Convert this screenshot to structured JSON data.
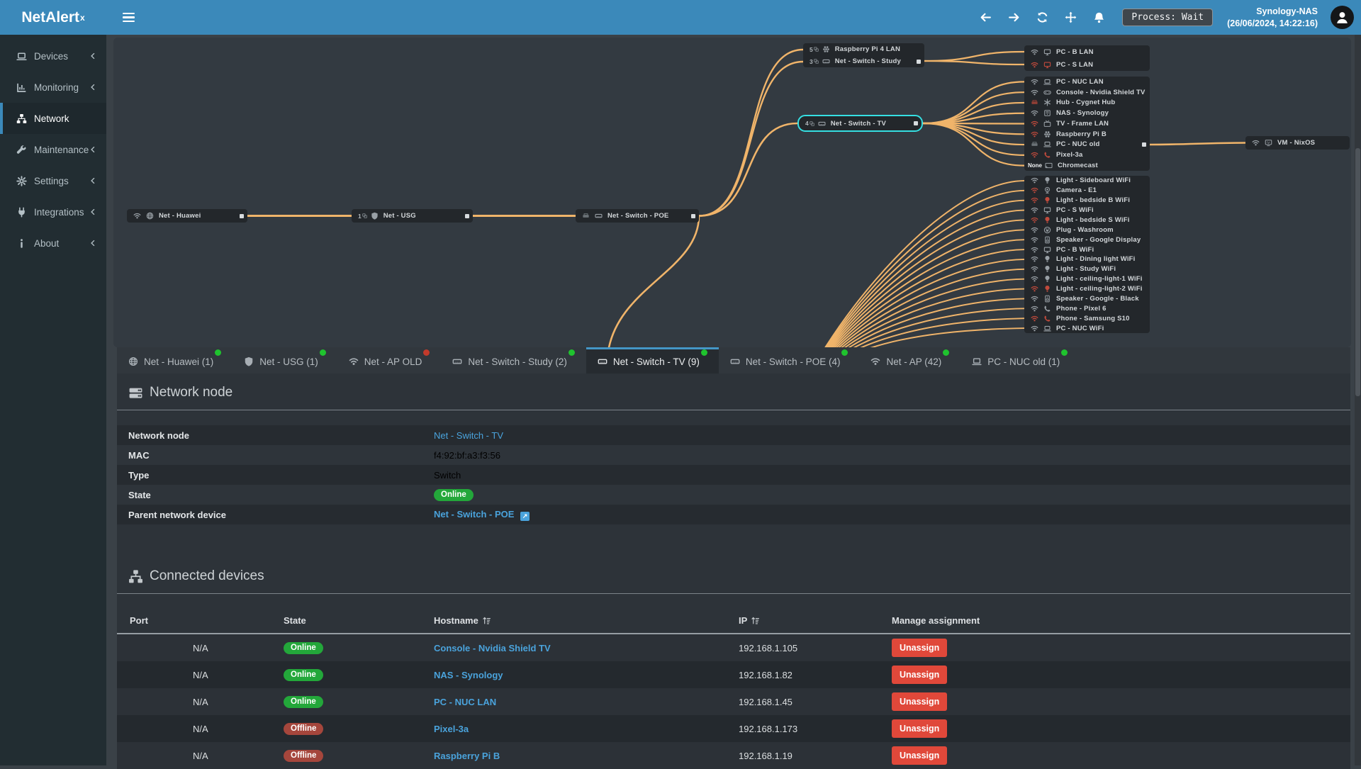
{
  "colors": {
    "topbar_blue": "#3b89ba",
    "sidebar_bg": "#222d32",
    "edge_orange": "#f0b46a",
    "selected_cyan": "#35dfe2",
    "link_blue": "#4aa3dc",
    "online_green": "#23a73a",
    "offline_maroon": "#a5463c",
    "danger_red": "#e0483a",
    "tab_dot_green": "#1fc32e",
    "tab_dot_red": "#c23a2b"
  },
  "topbar": {
    "logo": "NetAlert",
    "logo_sup": "x",
    "process": "Process: Wait",
    "host": "Synology-NAS",
    "time": "(26/06/2024, 14:22:16)"
  },
  "sidebar": {
    "items": [
      {
        "label": "Devices",
        "icon": "laptop-icon",
        "chevron": true,
        "active": false
      },
      {
        "label": "Monitoring",
        "icon": "chart-icon",
        "chevron": true,
        "active": false
      },
      {
        "label": "Network",
        "icon": "sitemap-icon",
        "chevron": false,
        "active": true
      },
      {
        "label": "Maintenance",
        "icon": "wrench-icon",
        "chevron": true,
        "active": false
      },
      {
        "label": "Settings",
        "icon": "gear-icon",
        "chevron": true,
        "active": false
      },
      {
        "label": "Integrations",
        "icon": "plug-icon",
        "chevron": true,
        "active": false
      },
      {
        "label": "About",
        "icon": "info-icon",
        "chevron": true,
        "active": false
      }
    ]
  },
  "topology": {
    "nodes": {
      "huawei": {
        "rows": [
          {
            "icons": [
              [
                "wifi-icon",
                "grey"
              ],
              [
                "globe-icon",
                "grey"
              ]
            ],
            "label": "Net - Huawei",
            "port": true
          }
        ]
      },
      "usg": {
        "rows": [
          {
            "count": "1",
            "icons": [
              [
                "shield-icon",
                "grey"
              ]
            ],
            "label": "Net - USG",
            "port": true
          }
        ]
      },
      "poe": {
        "rows": [
          {
            "icons": [
              [
                "ethernet-icon",
                "darkgrey"
              ],
              [
                "switch-icon",
                "grey"
              ]
            ],
            "label": "Net - Switch - POE",
            "port": true
          }
        ]
      },
      "study": {
        "rows": [
          {
            "count": "5",
            "icons": [
              [
                "raspberry-icon",
                "grey"
              ]
            ],
            "label": "Raspberry Pi 4 LAN"
          },
          {
            "count": "3",
            "icons": [
              [
                "switch-icon",
                "grey"
              ]
            ],
            "label": "Net - Switch - Study",
            "port": true
          }
        ]
      },
      "tv": {
        "selected": true,
        "rows": [
          {
            "count": "4",
            "icons": [
              [
                "switch-icon",
                "grey"
              ]
            ],
            "label": "Net - Switch - TV",
            "port": true
          }
        ]
      },
      "vm": {
        "rows": [
          {
            "icons": [
              [
                "wifi-icon",
                "grey"
              ],
              [
                "vm-icon",
                "grey"
              ]
            ],
            "label": "VM - NixOS"
          }
        ]
      },
      "group1": {
        "rows": [
          {
            "status": [
              "wifi-icon",
              "grey"
            ],
            "device": [
              "monitor-icon",
              "grey"
            ],
            "label": "PC - B LAN"
          },
          {
            "status": [
              "wifi-icon",
              "red"
            ],
            "device": [
              "monitor-icon",
              "red"
            ],
            "label": "PC - S LAN"
          }
        ]
      },
      "group2": {
        "rows": [
          {
            "status": [
              "wifi-icon",
              "grey"
            ],
            "device": [
              "laptop-icon",
              "grey"
            ],
            "label": "PC - NUC LAN"
          },
          {
            "status": [
              "wifi-icon",
              "grey"
            ],
            "device": [
              "gamepad-icon",
              "grey"
            ],
            "label": "Console - Nvidia Shield TV"
          },
          {
            "status": [
              "ethernet-icon",
              "darkred"
            ],
            "device": [
              "hub-icon",
              "grey"
            ],
            "label": "Hub - Cygnet Hub"
          },
          {
            "status": [
              "wifi-icon",
              "grey"
            ],
            "device": [
              "nas-icon",
              "grey"
            ],
            "label": "NAS - Synology"
          },
          {
            "status": [
              "wifi-icon",
              "red"
            ],
            "device": [
              "tv-icon",
              "grey"
            ],
            "label": "TV - Frame LAN"
          },
          {
            "status": [
              "wifi-icon",
              "red"
            ],
            "device": [
              "raspberry-icon",
              "grey"
            ],
            "label": "Raspberry Pi B"
          },
          {
            "status": [
              "ethernet-icon",
              "darkgrey"
            ],
            "device": [
              "laptop-icon",
              "grey"
            ],
            "label": "PC - NUC old",
            "port": true
          },
          {
            "status": [
              "wifi-icon",
              "red"
            ],
            "device": [
              "phone-icon",
              "red"
            ],
            "label": "Pixel-3a"
          },
          {
            "status_text": "None",
            "device": [
              "chromecast-icon",
              "grey"
            ],
            "label": "Chromecast"
          }
        ]
      },
      "group3": {
        "rows": [
          {
            "status": [
              "wifi-icon",
              "grey"
            ],
            "device": [
              "bulb-icon",
              "grey"
            ],
            "label": "Light - Sideboard WiFi"
          },
          {
            "status": [
              "wifi-icon",
              "red"
            ],
            "device": [
              "camera-icon",
              "grey"
            ],
            "label": "Camera - E1"
          },
          {
            "status": [
              "wifi-icon",
              "red"
            ],
            "device": [
              "bulb-icon",
              "red"
            ],
            "label": "Light - bedside B WiFi"
          },
          {
            "status": [
              "wifi-icon",
              "grey"
            ],
            "device": [
              "monitor-icon",
              "grey"
            ],
            "label": "PC - S WiFi"
          },
          {
            "status": [
              "wifi-icon",
              "red"
            ],
            "device": [
              "bulb-icon",
              "red"
            ],
            "label": "Light - bedside S WiFi"
          },
          {
            "status": [
              "wifi-icon",
              "grey"
            ],
            "device": [
              "smartplug-icon",
              "grey"
            ],
            "label": "Plug - Washroom"
          },
          {
            "status": [
              "wifi-icon",
              "grey"
            ],
            "device": [
              "speaker-icon",
              "grey"
            ],
            "label": "Speaker - Google Display"
          },
          {
            "status": [
              "wifi-icon",
              "grey"
            ],
            "device": [
              "monitor-icon",
              "grey"
            ],
            "label": "PC - B WiFi"
          },
          {
            "status": [
              "wifi-icon",
              "grey"
            ],
            "device": [
              "bulb-icon",
              "grey"
            ],
            "label": "Light - Dining light WiFi"
          },
          {
            "status": [
              "wifi-icon",
              "grey"
            ],
            "device": [
              "bulb-icon",
              "grey"
            ],
            "label": "Light - Study WiFi"
          },
          {
            "status": [
              "wifi-icon",
              "grey"
            ],
            "device": [
              "bulb-icon",
              "grey"
            ],
            "label": "Light - ceiling-light-1 WiFi"
          },
          {
            "status": [
              "wifi-icon",
              "red"
            ],
            "device": [
              "bulb-icon",
              "red"
            ],
            "label": "Light - ceiling-light-2 WiFi"
          },
          {
            "status": [
              "wifi-icon",
              "grey"
            ],
            "device": [
              "speaker-icon",
              "grey"
            ],
            "label": "Speaker - Google - Black"
          },
          {
            "status": [
              "wifi-icon",
              "grey"
            ],
            "device": [
              "phone-icon",
              "grey"
            ],
            "label": "Phone - Pixel 6"
          },
          {
            "status": [
              "wifi-icon",
              "red"
            ],
            "device": [
              "phone-icon",
              "red"
            ],
            "label": "Phone - Samsung S10"
          },
          {
            "status": [
              "wifi-icon",
              "grey"
            ],
            "device": [
              "laptop-icon",
              "grey"
            ],
            "label": "PC - NUC WiFi"
          }
        ]
      }
    }
  },
  "tabs": {
    "items": [
      {
        "label": "Net - Huawei (1)",
        "icon": "globe-icon",
        "dot": "green",
        "active": false
      },
      {
        "label": "Net - USG (1)",
        "icon": "shield-icon",
        "dot": "green",
        "active": false
      },
      {
        "label": "Net - AP OLD",
        "icon": "wifi-icon",
        "dot": "red",
        "active": false
      },
      {
        "label": "Net - Switch - Study (2)",
        "icon": "switch-icon",
        "dot": "green",
        "active": false
      },
      {
        "label": "Net - Switch - TV (9)",
        "icon": "switch-icon",
        "dot": "green",
        "active": true
      },
      {
        "label": "Net - Switch - POE (4)",
        "icon": "switch-icon",
        "dot": "green",
        "active": false
      },
      {
        "label": "Net - AP (42)",
        "icon": "wifi-icon",
        "dot": "green",
        "active": false
      },
      {
        "label": "PC - NUC old (1)",
        "icon": "laptop-icon",
        "dot": "green",
        "active": false
      }
    ]
  },
  "network_node": {
    "title": "Network node",
    "rows": [
      {
        "label": "Network node",
        "type": "link",
        "value": "Net - Switch - TV"
      },
      {
        "label": "MAC",
        "type": "text",
        "value": "f4:92:bf:a3:f3:56"
      },
      {
        "label": "Type",
        "type": "text",
        "value": "Switch"
      },
      {
        "label": "State",
        "type": "badge",
        "value": "Online"
      },
      {
        "label": "Parent network device",
        "type": "link-ext",
        "value": "Net - Switch - POE"
      }
    ]
  },
  "connected_devices": {
    "title": "Connected devices",
    "columns": [
      {
        "label": "Port",
        "sort": false
      },
      {
        "label": "State",
        "sort": false
      },
      {
        "label": "Hostname",
        "sort": true
      },
      {
        "label": "IP",
        "sort": true
      },
      {
        "label": "Manage assignment",
        "sort": false
      }
    ],
    "rows": [
      {
        "port": "N/A",
        "state": "Online",
        "hostname": "Console - Nvidia Shield TV",
        "ip": "192.168.1.105",
        "action": "Unassign"
      },
      {
        "port": "N/A",
        "state": "Online",
        "hostname": "NAS - Synology",
        "ip": "192.168.1.82",
        "action": "Unassign"
      },
      {
        "port": "N/A",
        "state": "Online",
        "hostname": "PC - NUC LAN",
        "ip": "192.168.1.45",
        "action": "Unassign"
      },
      {
        "port": "N/A",
        "state": "Offline",
        "hostname": "Pixel-3a",
        "ip": "192.168.1.173",
        "action": "Unassign"
      },
      {
        "port": "N/A",
        "state": "Offline",
        "hostname": "Raspberry Pi B",
        "ip": "192.168.1.19",
        "action": "Unassign"
      }
    ]
  }
}
